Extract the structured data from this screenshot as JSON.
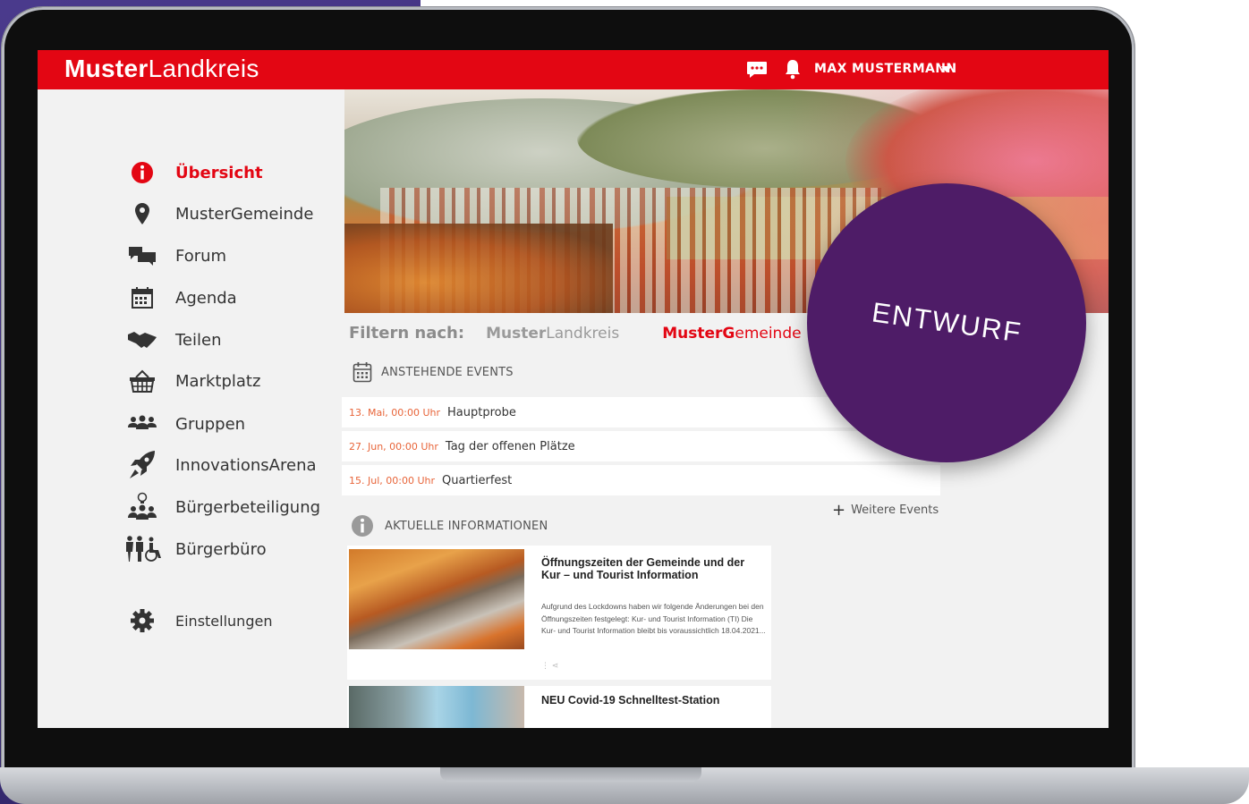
{
  "app": {
    "brand_bold": "Muster",
    "brand_light": "Landkreis",
    "user_name": "MAX MUSTERMANN"
  },
  "sidebar": {
    "items": [
      {
        "label": "Übersicht",
        "icon": "info-icon",
        "active": true
      },
      {
        "label": "MusterGemeinde",
        "icon": "map-pin-icon"
      },
      {
        "label": "Forum",
        "icon": "chat-bubbles-icon"
      },
      {
        "label": "Agenda",
        "icon": "calendar-icon"
      },
      {
        "label": "Teilen",
        "icon": "handshake-icon"
      },
      {
        "label": "Marktplatz",
        "icon": "basket-icon"
      },
      {
        "label": "Gruppen",
        "icon": "group-icon"
      },
      {
        "label": "InnovationsArena",
        "icon": "rocket-icon"
      },
      {
        "label": "Bürgerbeteiligung",
        "icon": "participation-icon"
      },
      {
        "label": "Bürgerbüro",
        "icon": "citizens-office-icon"
      }
    ],
    "settings_label": "Einstellungen"
  },
  "filter": {
    "label": "Filtern nach:",
    "option1_bold": "Muster",
    "option1_light": "Landkreis",
    "option2_bold": "MusterG",
    "option2_light": "emeinde"
  },
  "events": {
    "title": "ANSTEHENDE EVENTS",
    "items": [
      {
        "date": "13. Mai, 00:00 Uhr",
        "title": "Hauptprobe"
      },
      {
        "date": "27. Jun, 00:00 Uhr",
        "title": "Tag der offenen Plätze"
      },
      {
        "date": "15. Jul, 00:00 Uhr",
        "title": "Quartierfest"
      }
    ],
    "more_label": "Weitere Events"
  },
  "news": {
    "title": "AKTUELLE INFORMATIONEN",
    "items": [
      {
        "title": "Öffnungszeiten der Gemeinde und der Kur – und Tourist Information",
        "text": "Aufgrund des Lockdowns haben wir folgende Änderungen bei den Öffnungszeiten festgelegt: Kur- und Tourist Information (TI) Die Kur- und Tourist Information bleibt bis voraussichtlich 18.04.2021..."
      },
      {
        "title": "NEU Covid-19 Schnelltest-Station",
        "text": ""
      }
    ]
  },
  "badge": {
    "label": "ENTWURF",
    "color": "#4e1c67"
  },
  "colors": {
    "brand_red": "#e30613",
    "date_orange": "#e8653a"
  }
}
